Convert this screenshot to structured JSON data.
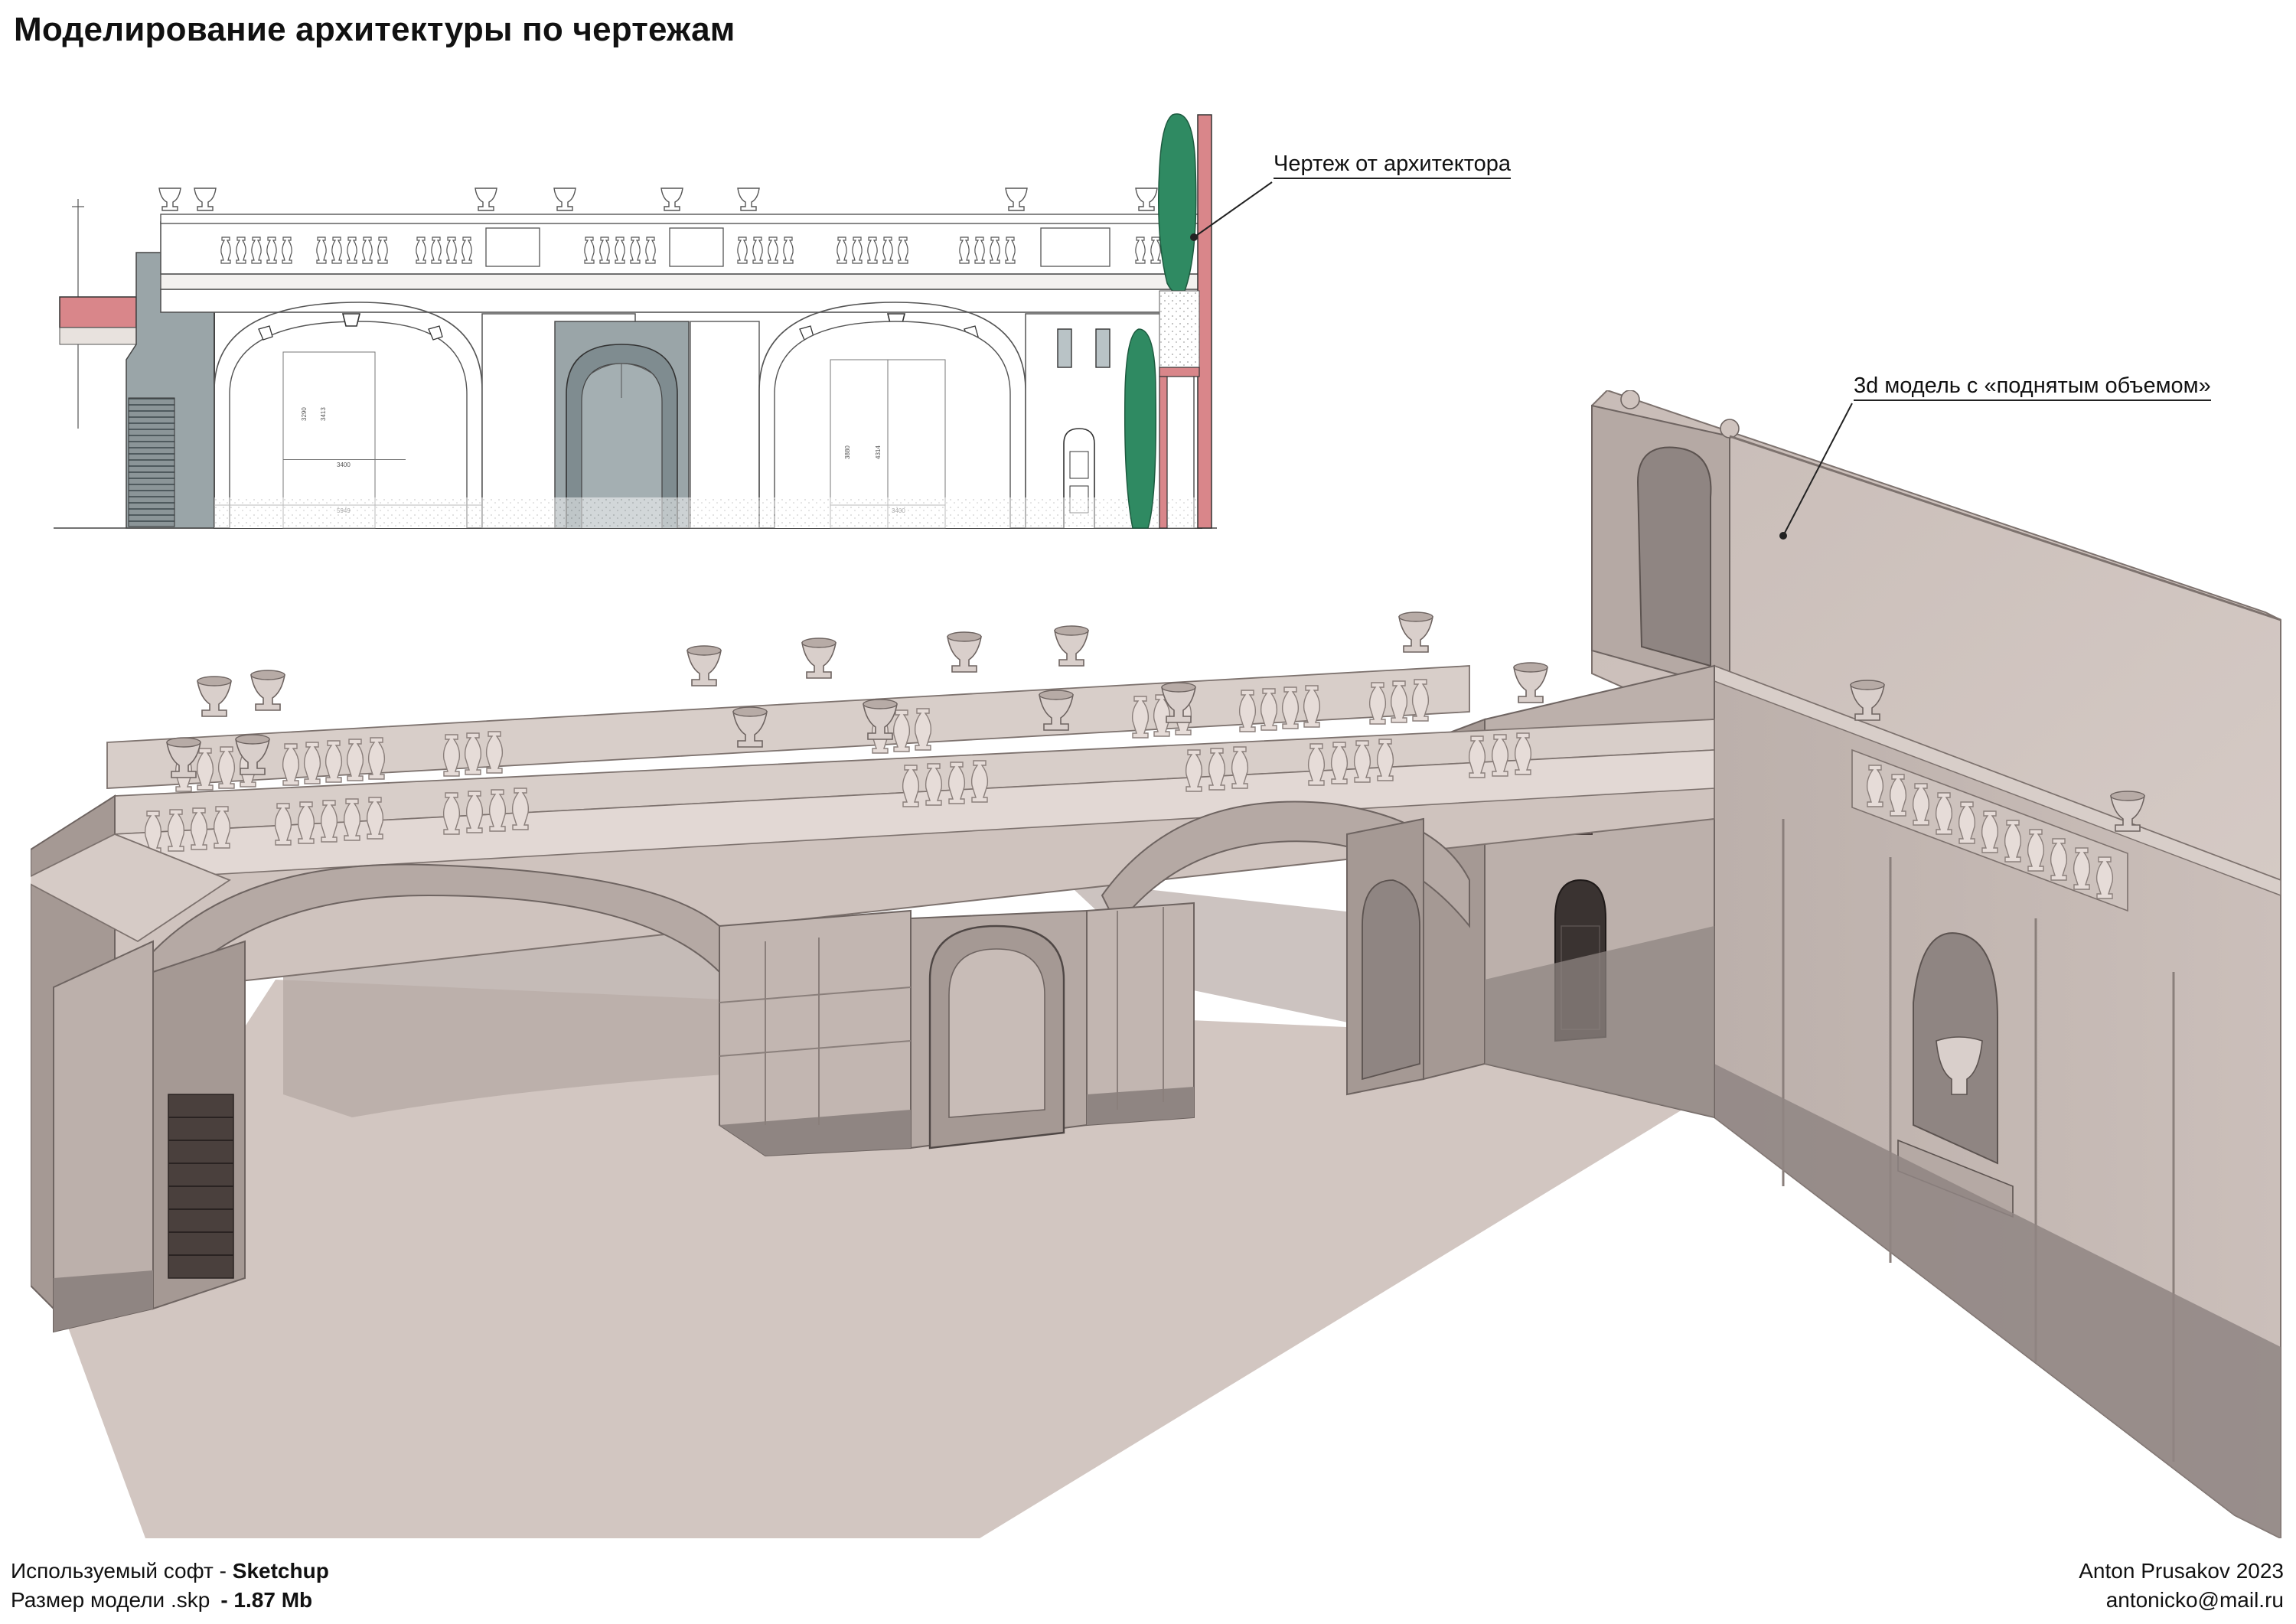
{
  "title": "Моделирование архитектуры  по чертежам",
  "annotations": {
    "drawing_label": "Чертеж от архитектора",
    "model_label": "3d модель с «поднятым объемом»"
  },
  "drawing_dims": {
    "d1": "3400",
    "d2": "5949",
    "d3": "3400",
    "h1": "3290",
    "h2": "3413",
    "h3": "3880",
    "h4": "4314"
  },
  "footer": {
    "software_label": "Используемый софт - ",
    "software_value": "Sketchup",
    "size_label": "Размер модели .skp",
    "size_value": "- 1.87 Mb",
    "author": "Anton Prusakov 2023",
    "email": "antonicko@mail.ru"
  },
  "colors": {
    "stone": "#cfc3be",
    "stone_shadow": "#8f8582",
    "ground": "#d2c6c1",
    "cypress": "#2f8a62",
    "section_pink": "#d9868a",
    "window_pink": "#d98ac4"
  }
}
